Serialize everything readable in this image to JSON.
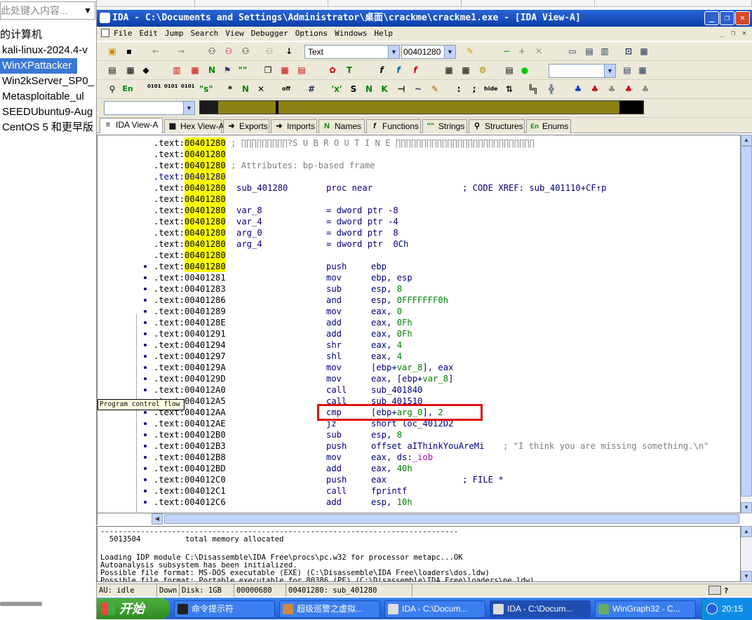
{
  "library": {
    "search_placeholder": "此处键入内容...",
    "my_computer": "的计算机",
    "vms": [
      "kali-linux-2024.4-v",
      "WinXPattacker",
      "Win2kServer_SP0_",
      "Metasploitable_ul",
      "SEEDUbuntu9-Aug",
      "CentOS 5 和更早版"
    ],
    "selected": "WinXPattacker"
  },
  "window": {
    "title": "IDA - C:\\Documents and Settings\\Administrator\\桌面\\crackme\\crackme1.exe - [IDA View-A]",
    "menu": [
      "File",
      "Edit",
      "Jump",
      "Search",
      "View",
      "Debugger",
      "Options",
      "Windows",
      "Help"
    ]
  },
  "toolbar": {
    "search_type": "Text",
    "address": "00401280"
  },
  "tabs": [
    {
      "label": "IDA View-A",
      "icon": "ida-view-icon",
      "glyph": "≡"
    },
    {
      "label": "Hex View-A",
      "icon": "hex-view-icon",
      "glyph": "▦"
    },
    {
      "label": "Exports",
      "icon": "exports-icon",
      "glyph": "➜"
    },
    {
      "label": "Imports",
      "icon": "imports-icon",
      "glyph": "➜"
    },
    {
      "label": "Names",
      "icon": "names-icon",
      "glyph": "N"
    },
    {
      "label": "Functions",
      "icon": "functions-icon",
      "glyph": "f"
    },
    {
      "label": "Strings",
      "icon": "strings-icon",
      "glyph": "\"\""
    },
    {
      "label": "Structures",
      "icon": "structures-icon",
      "glyph": "⚲"
    },
    {
      "label": "Enums",
      "icon": "enums-icon",
      "glyph": "En"
    }
  ],
  "disasm": [
    {
      "addr": ".text:00401280",
      "hl": true,
      "raw": " ; ∏∏∏∏∏∏∏∏∏?S U B R O U T I N E ∏∏∏∏∏∏∏∏∏∏∏∏∏∏∏∏∏∏∏∏∏∏∏∏∏∏∏",
      "kind": "cmt"
    },
    {
      "addr": ".text:00401280",
      "hl": true
    },
    {
      "addr": ".text:00401280",
      "hl": true,
      "raw": " ; Attributes: bp-based frame",
      "kind": "cmt"
    },
    {
      "addr": ".text:00401280",
      "hl": true,
      "blue": true
    },
    {
      "addr": ".text:00401280",
      "hl": true,
      "label": "sub_401280",
      "mn": "proc near",
      "cmt": "; CODE XREF: sub_401110+CF↑p"
    },
    {
      "addr": ".text:00401280",
      "hl": true
    },
    {
      "addr": ".text:00401280",
      "hl": true,
      "label": "var_8",
      "mn": "= dword ptr -8"
    },
    {
      "addr": ".text:00401280",
      "hl": true,
      "label": "var_4",
      "mn": "= dword ptr -4"
    },
    {
      "addr": ".text:00401280",
      "hl": true,
      "label": "arg_0",
      "mn": "= dword ptr  8"
    },
    {
      "addr": ".text:00401280",
      "hl": true,
      "label": "arg_4",
      "mn": "= dword ptr  0Ch"
    },
    {
      "addr": ".text:00401280",
      "hl": true
    },
    {
      "addr": ".text:00401280",
      "hl": true,
      "mn": "push",
      "op": "ebp",
      "dot": true
    },
    {
      "addr": ".text:00401281",
      "mn": "mov",
      "op": "ebp, esp",
      "dot": true
    },
    {
      "addr": ".text:00401283",
      "mn": "sub",
      "op": "esp, 8",
      "dot": true
    },
    {
      "addr": ".text:00401286",
      "mn": "and",
      "op": "esp, 0FFFFFFF0h",
      "dot": true
    },
    {
      "addr": ".text:00401289",
      "mn": "mov",
      "op": "eax, 0",
      "dot": true
    },
    {
      "addr": ".text:0040128E",
      "mn": "add",
      "op": "eax, 0Fh",
      "dot": true
    },
    {
      "addr": ".text:00401291",
      "mn": "add",
      "op": "eax, 0Fh",
      "dot": true
    },
    {
      "addr": ".text:00401294",
      "mn": "shr",
      "op": "eax, 4",
      "dot": true
    },
    {
      "addr": ".text:00401297",
      "mn": "shl",
      "op": "eax, 4",
      "dot": true
    },
    {
      "addr": ".text:0040129A",
      "mn": "mov",
      "op": "[ebp+var_8], eax",
      "dot": true
    },
    {
      "addr": ".text:0040129D",
      "mn": "mov",
      "op": "eax, [ebp+var_8]",
      "dot": true
    },
    {
      "addr": ".text:004012A0",
      "mn": "call",
      "op": "sub_401840",
      "dot": true
    },
    {
      "addr": ".text:004012A5",
      "mn": "call",
      "op": "sub_401510",
      "dot": true
    },
    {
      "addr": ".text:004012AA",
      "mn": "cmp",
      "op": "[ebp+arg_0], 2",
      "dot": true
    },
    {
      "addr": ".text:004012AE",
      "mn": "jz",
      "op": "short loc_4012D2",
      "dot": true
    },
    {
      "addr": ".text:004012B0",
      "mn": "sub",
      "op": "esp, 8",
      "dot": true
    },
    {
      "addr": ".text:004012B3",
      "mn": "push",
      "op": "offset aIThinkYouAreMi",
      "cmt": "; \"I think you are missing something.\\n\"",
      "dot": true
    },
    {
      "addr": ".text:004012B8",
      "mn": "mov",
      "op": "eax, ds:_iob",
      "dot": true
    },
    {
      "addr": ".text:004012BD",
      "mn": "add",
      "op": "eax, 40h",
      "dot": true
    },
    {
      "addr": ".text:004012C0",
      "mn": "push",
      "op": "eax",
      "cmt": "; FILE *",
      "dot": true
    },
    {
      "addr": ".text:004012C1",
      "mn": "call",
      "op": "fprintf",
      "dot": true
    },
    {
      "addr": ".text:004012C6",
      "mn": "add",
      "op": "esp, 10h",
      "dot": true
    }
  ],
  "tooltip": "Program control flow",
  "output": [
    "--------------------------------------------------------------------------------",
    "  5013504          total memory allocated",
    "",
    "Loading IDP module C:\\Disassemble\\IDA Free\\procs\\pc.w32 for processor metapc...OK",
    "Autoanalysis subsystem has been initialized.",
    "Possible file format: MS-DOS executable (EXE) (C:\\Disassemble\\IDA Free\\loaders\\dos.ldw)",
    "Possible file format: Portable executable for 80386 (PE) (C:\\Disassemble\\IDA Free\\loaders\\pe.ldw)"
  ],
  "status": {
    "au": "AU:  idle",
    "dir": "Down",
    "disk": "Disk: 1GB",
    "offset": "00000680",
    "loc": "00401280: sub_401280"
  },
  "taskbar": {
    "start": "开始",
    "items": [
      "命令提示符",
      "超级巡警之虚拟...",
      "IDA - C:\\Docum...",
      "IDA - C:\\Docum...",
      "WinGraph32 - C..."
    ],
    "active_index": 3,
    "time": "20:15"
  },
  "colors": {
    "highlight": "#ffff00",
    "title_bar": "#0a3ea8",
    "red_box": "#e01010",
    "selected_vm": "#3a78d4"
  }
}
